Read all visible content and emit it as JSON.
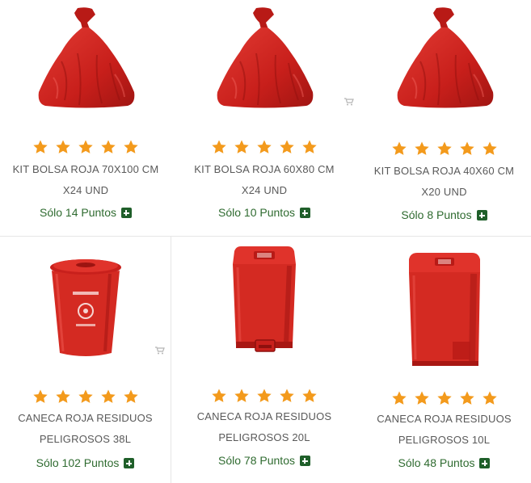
{
  "products": [
    {
      "image": "red-trash-bag",
      "rating": 5,
      "title_line1": "KIT BOLSA ROJA 70X100 CM",
      "title_line2": "X24 UND",
      "price": "Sólo 14 Puntos"
    },
    {
      "image": "red-trash-bag",
      "rating": 5,
      "title_line1": "KIT BOLSA ROJA 60X80 CM",
      "title_line2": "X24 UND",
      "price": "Sólo 10 Puntos"
    },
    {
      "image": "red-trash-bag",
      "rating": 5,
      "title_line1": "KIT BOLSA ROJA 40X60 CM",
      "title_line2": "X20 UND",
      "price": "Sólo 8 Puntos"
    },
    {
      "image": "red-round-bin",
      "rating": 5,
      "title_line1": "CANECA ROJA RESIDUOS",
      "title_line2": "PELIGROSOS 38L",
      "price": "Sólo 102 Puntos"
    },
    {
      "image": "red-pedal-bin",
      "rating": 5,
      "title_line1": "CANECA ROJA RESIDUOS",
      "title_line2": "PELIGROSOS 20L",
      "price": "Sólo 78 Puntos"
    },
    {
      "image": "red-pedal-bin",
      "rating": 5,
      "title_line1": "CANECA ROJA RESIDUOS",
      "title_line2": "PELIGROSOS 10L",
      "price": "Sólo 48 Puntos"
    }
  ],
  "colors": {
    "star": "#f39a1c",
    "price": "#2f6b30",
    "add_button": "#1f5f2a",
    "product_red": "#d42a22"
  }
}
